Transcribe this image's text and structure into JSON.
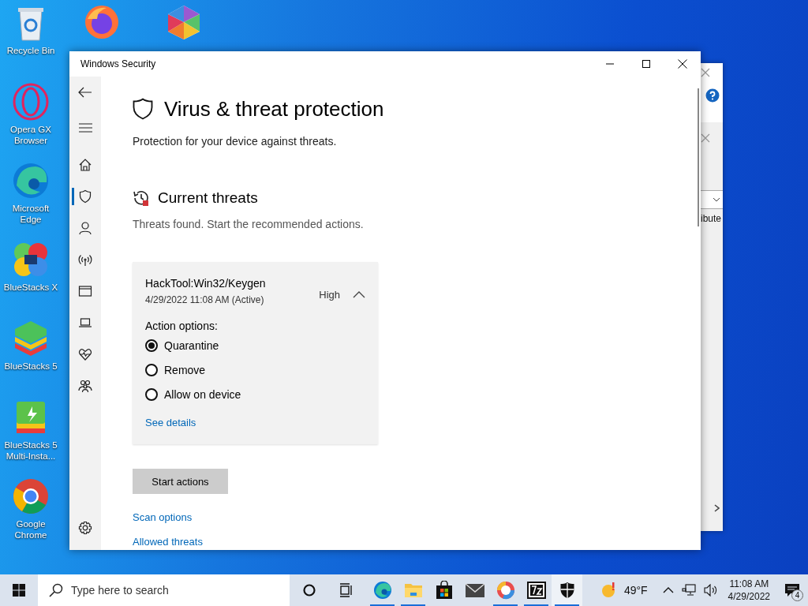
{
  "desktop_top_icons": [
    {
      "kind": "firefox"
    },
    {
      "kind": "multi"
    }
  ],
  "desktop_icons": [
    {
      "kind": "recycle",
      "label": "Recycle Bin"
    },
    {
      "kind": "opera",
      "label": "Opera GX Browser"
    },
    {
      "kind": "edge",
      "label": "Microsoft Edge"
    },
    {
      "kind": "bluestacksx",
      "label": "BlueStacks X"
    },
    {
      "kind": "bluestacks",
      "label": "BlueStacks 5"
    },
    {
      "kind": "bluestacksmulti",
      "label": "BlueStacks 5 Multi-Insta..."
    },
    {
      "kind": "chrome",
      "label": "Google Chrome"
    }
  ],
  "background_window": {
    "column_text": "ibute"
  },
  "window": {
    "title": "Windows Security",
    "nav": [
      {
        "kind": "home",
        "selected": false
      },
      {
        "kind": "shield",
        "selected": true
      },
      {
        "kind": "account",
        "selected": false
      },
      {
        "kind": "network",
        "selected": false
      },
      {
        "kind": "app",
        "selected": false
      },
      {
        "kind": "device",
        "selected": false
      },
      {
        "kind": "health",
        "selected": false
      },
      {
        "kind": "family",
        "selected": false
      }
    ],
    "heading": "Virus & threat protection",
    "subtitle": "Protection for your device against threats.",
    "section_title": "Current threats",
    "section_subtitle": "Threats found. Start the recommended actions.",
    "threat": {
      "name": "HackTool:Win32/Keygen",
      "date": "4/29/2022 11:08 AM (Active)",
      "severity": "High",
      "expanded": true,
      "options_label": "Action options:",
      "options": [
        {
          "label": "Quarantine",
          "selected": true
        },
        {
          "label": "Remove",
          "selected": false
        },
        {
          "label": "Allow on device",
          "selected": false
        }
      ],
      "details_link": "See details"
    },
    "primary_button": "Start actions",
    "links": [
      "Scan options",
      "Allowed threats"
    ]
  },
  "taskbar": {
    "search_placeholder": "Type here to search",
    "apps": [
      {
        "kind": "cortana",
        "running": false,
        "selected": false
      },
      {
        "kind": "taskview",
        "running": false,
        "selected": false
      },
      {
        "kind": "edge",
        "running": true,
        "selected": false
      },
      {
        "kind": "explorer",
        "running": true,
        "selected": false
      },
      {
        "kind": "store",
        "running": false,
        "selected": false
      },
      {
        "kind": "mail",
        "running": false,
        "selected": false
      },
      {
        "kind": "browser",
        "running": true,
        "selected": false
      },
      {
        "kind": "sevenzip",
        "running": true,
        "selected": false
      },
      {
        "kind": "security",
        "running": true,
        "selected": true
      }
    ],
    "temperature": "49°F",
    "time": "11:08 AM",
    "date": "4/29/2022",
    "notifications": "4"
  }
}
